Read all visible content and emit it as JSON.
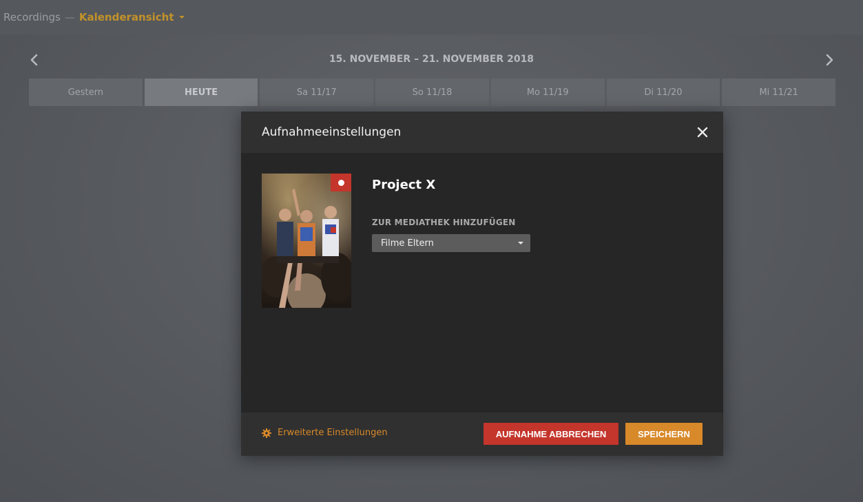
{
  "topbar": {
    "section": "Recordings",
    "separator": "—",
    "view": "Kalenderansicht",
    "view_caret_icon": "caret-down-icon"
  },
  "calendar": {
    "range": "15. NOVEMBER – 21. NOVEMBER 2018",
    "prev_icon": "chevron-left-icon",
    "next_icon": "chevron-right-icon",
    "days": [
      "Gestern",
      "HEUTE",
      "Sa 11/17",
      "So 11/18",
      "Mo 11/19",
      "Di 11/20",
      "Mi 11/21"
    ],
    "active_day": "HEUTE"
  },
  "modal": {
    "title": "Aufnahmeeinstellungen",
    "close_icon": "close-icon",
    "item": {
      "title": "Project X",
      "recording_badge_icon": "record-dot-icon"
    },
    "library": {
      "label": "ZUR MEDIATHEK HINZUFÜGEN",
      "selected": "Filme Eltern"
    },
    "footer": {
      "advanced_label": "Erweiterte Einstellungen",
      "advanced_icon": "gear-icon",
      "cancel_label": "AUFNAHME ABBRECHEN",
      "save_label": "SPEICHERN"
    }
  },
  "colors": {
    "accent": "#d8892a",
    "danger": "#c4352b",
    "view_accent": "#c2922a"
  }
}
